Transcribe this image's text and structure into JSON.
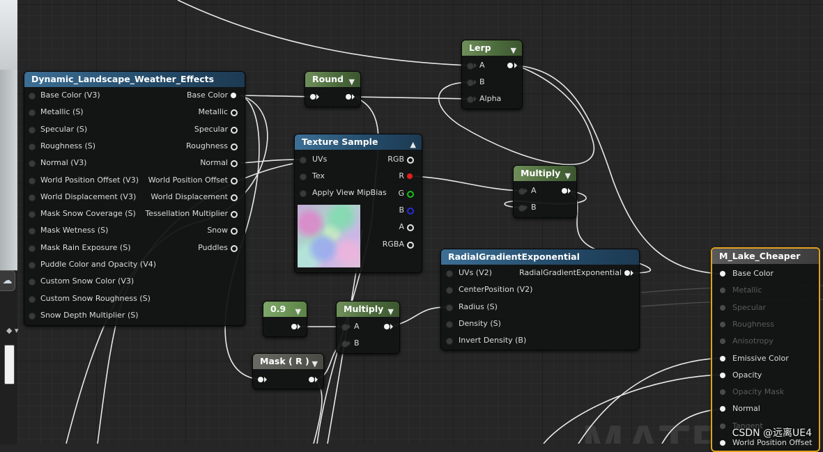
{
  "graph_background_text": "MATER",
  "watermark": "CSDN @远离UE4",
  "nodes": {
    "weather": {
      "title": "Dynamic_Landscape_Weather_Effects",
      "inputs": [
        "Base Color (V3)",
        "Metallic (S)",
        "Specular (S)",
        "Roughness (S)",
        "Normal (V3)",
        "World Position Offset (V3)",
        "World Displacement (V3)",
        "Mask Snow Coverage (S)",
        "Mask Wetness (S)",
        "Mask Rain Exposure (S)",
        "Puddle Color and Opacity (V4)",
        "Custom Snow Color (V3)",
        "Custom Snow Roughness (S)",
        "Snow Depth Multiplier (S)"
      ],
      "outputs": [
        "Base Color",
        "Metallic",
        "Specular",
        "Roughness",
        "Normal",
        "World Position Offset",
        "World Displacement",
        "Tessellation Multiplier",
        "Snow",
        "Puddles"
      ]
    },
    "round": {
      "title": "Round"
    },
    "lerp": {
      "title": "Lerp",
      "inputs": [
        "A",
        "B",
        "Alpha"
      ]
    },
    "texture": {
      "title": "Texture Sample",
      "inputs": [
        "UVs",
        "Tex",
        "Apply View MipBias"
      ],
      "outputs": [
        "RGB",
        "R",
        "G",
        "B",
        "A",
        "RGBA"
      ]
    },
    "multiply1": {
      "title": "Multiply",
      "inputs": [
        "A",
        "B"
      ]
    },
    "radial": {
      "title": "RadialGradientExponential",
      "inputs": [
        "UVs (V2)",
        "CenterPosition (V2)",
        "Radius (S)",
        "Density (S)",
        "Invert Density (B)"
      ],
      "output": "RadialGradientExponential"
    },
    "constant": {
      "title": "0.9"
    },
    "multiply2": {
      "title": "Multiply",
      "inputs": [
        "A",
        "B"
      ]
    },
    "mask": {
      "title": "Mask ( R )"
    },
    "result": {
      "title": "M_Lake_Cheaper",
      "pins": [
        {
          "label": "Base Color",
          "active": true
        },
        {
          "label": "Metallic",
          "active": false
        },
        {
          "label": "Specular",
          "active": false
        },
        {
          "label": "Roughness",
          "active": false
        },
        {
          "label": "Anisotropy",
          "active": false
        },
        {
          "label": "Emissive Color",
          "active": true
        },
        {
          "label": "Opacity",
          "active": true
        },
        {
          "label": "Opacity Mask",
          "active": false
        },
        {
          "label": "Normal",
          "active": true
        },
        {
          "label": "Tangent",
          "active": false
        },
        {
          "label": "World Position Offset",
          "active": true
        }
      ]
    }
  },
  "colors": {
    "accent": "#e3a320",
    "header_blue": "#2b5577",
    "header_green": "#5a7a48",
    "pin_red": "#e51d1d",
    "pin_green": "#19c019",
    "pin_blue": "#2a2ad8"
  }
}
